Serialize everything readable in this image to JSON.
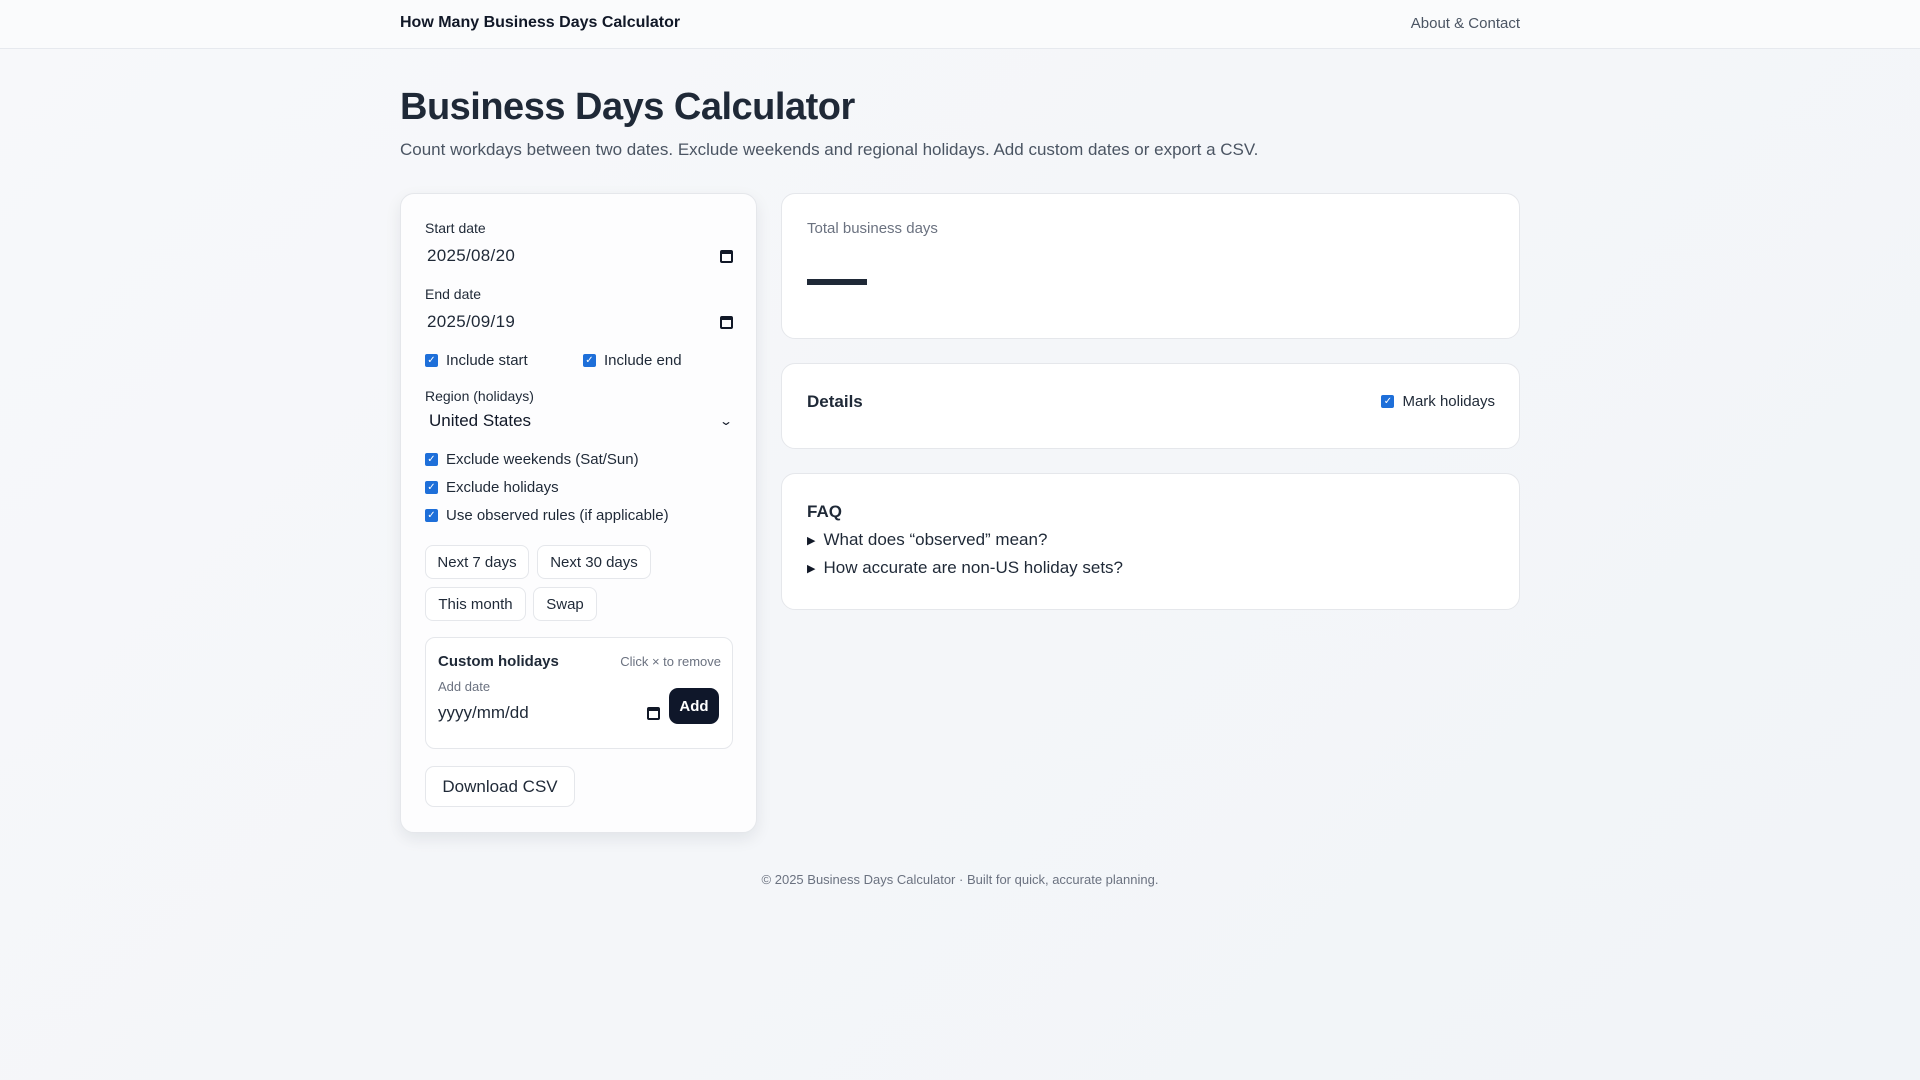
{
  "header": {
    "brand": "How Many Business Days Calculator",
    "nav_link": "About & Contact"
  },
  "page": {
    "title": "Business Days Calculator",
    "subtitle": "Count workdays between two dates. Exclude weekends and regional holidays. Add custom dates or export a CSV."
  },
  "form": {
    "start_label": "Start date",
    "start_value": "2025/08/20",
    "end_label": "End date",
    "end_value": "2025/09/19",
    "include_start": "Include start",
    "include_end": "Include end",
    "region_label": "Region (holidays)",
    "region_value": "United States",
    "exclude_weekends": "Exclude weekends (Sat/Sun)",
    "exclude_holidays": "Exclude holidays",
    "observed_rules": "Use observed rules (if applicable)",
    "quick_buttons": [
      "Next 7 days",
      "Next 30 days",
      "This month",
      "Swap"
    ],
    "checked_mark": "✓"
  },
  "custom_holidays": {
    "title": "Custom holidays",
    "hint": "Click × to remove",
    "add_label": "Add date",
    "placeholder": "yyyy/mm/dd",
    "add_button": "Add"
  },
  "download_button": "Download CSV",
  "results": {
    "total_label": "Total business days",
    "details_title": "Details",
    "mark_holidays": "Mark holidays"
  },
  "faq": {
    "title": "FAQ",
    "items": [
      "What does “observed” mean?",
      "How accurate are non-US holiday sets?"
    ]
  },
  "footer": "© 2025 Business Days Calculator · Built for quick, accurate planning.",
  "colors": {
    "accent": "#1e6fd9",
    "primary_button": "#0f172a"
  },
  "icons": {
    "calendar": "calendar-icon",
    "chevron": "chevron-down-icon",
    "disclosure": "triangle-right-icon"
  }
}
